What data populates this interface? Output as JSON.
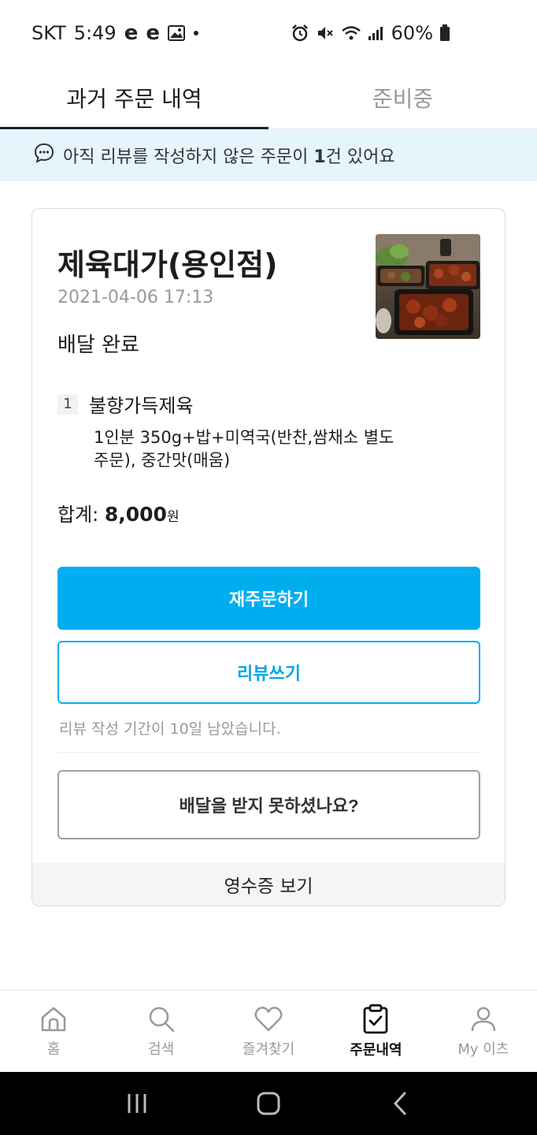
{
  "status_bar": {
    "carrier": "SKT",
    "time": "5:49",
    "notif_icons": [
      "e",
      "e"
    ],
    "battery": "60%"
  },
  "tabs": [
    {
      "label": "과거 주문 내역",
      "active": true
    },
    {
      "label": "준비중",
      "active": false
    }
  ],
  "notice": {
    "prefix": "아직 리뷰를 작성하지 않은 주문이 ",
    "count": "1",
    "suffix": "건 있어요"
  },
  "order": {
    "store_name": "제육대가(용인점)",
    "date": "2021-04-06 17:13",
    "status": "배달 완료",
    "items": [
      {
        "qty": "1",
        "name": "불향가득제육",
        "option": "1인분 350g+밥+미역국(반찬,쌈채소 별도주문), 중간맛(매움)"
      }
    ],
    "total_label": "합계: ",
    "total_amount": "8,000",
    "total_unit": "원",
    "reorder_label": "재주문하기",
    "review_label": "리뷰쓰기",
    "review_period": "리뷰 작성 기간이 10일 남았습니다.",
    "undelivered_label": "배달을 받지 못하셨나요?",
    "receipt_label": "영수증 보기"
  },
  "bottom_nav": [
    {
      "label": "홈",
      "icon": "home-icon",
      "active": false
    },
    {
      "label": "검색",
      "icon": "search-icon",
      "active": false
    },
    {
      "label": "즐겨찾기",
      "icon": "heart-icon",
      "active": false
    },
    {
      "label": "주문내역",
      "icon": "clipboard-check-icon",
      "active": true
    },
    {
      "label": "My 이츠",
      "icon": "person-icon",
      "active": false
    }
  ],
  "colors": {
    "accent": "#00aeef",
    "notice_bg": "#e6f4fb",
    "tab_indicator": "#1d1d3a"
  }
}
